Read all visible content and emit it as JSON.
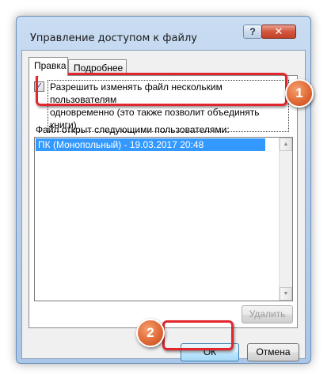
{
  "window": {
    "title": "Управление доступом к файлу"
  },
  "tabs": [
    {
      "label": "Правка",
      "active": true
    },
    {
      "label": "Подробнее",
      "active": false
    }
  ],
  "checkbox": {
    "checked": true,
    "label_line1": "Разрешить изменять файл нескольким пользователям",
    "label_line2": "одновременно (это также позволит объединять книги)"
  },
  "users_list": {
    "label": "Файл открыт следующими пользователями:",
    "items": [
      "ПК (Монопольный) - 19.03.2017 20:48"
    ]
  },
  "buttons": {
    "delete": "Удалить",
    "ok": "ОК",
    "cancel": "Отмена"
  },
  "callouts": {
    "step1": "1",
    "step2": "2"
  },
  "icons": {
    "help": "?",
    "close": "✕",
    "check": "✓",
    "up": "▲",
    "down": "▼"
  },
  "colors": {
    "selection": "#3399ff",
    "callout_border": "#e1262d",
    "badge": "#e06a37"
  }
}
